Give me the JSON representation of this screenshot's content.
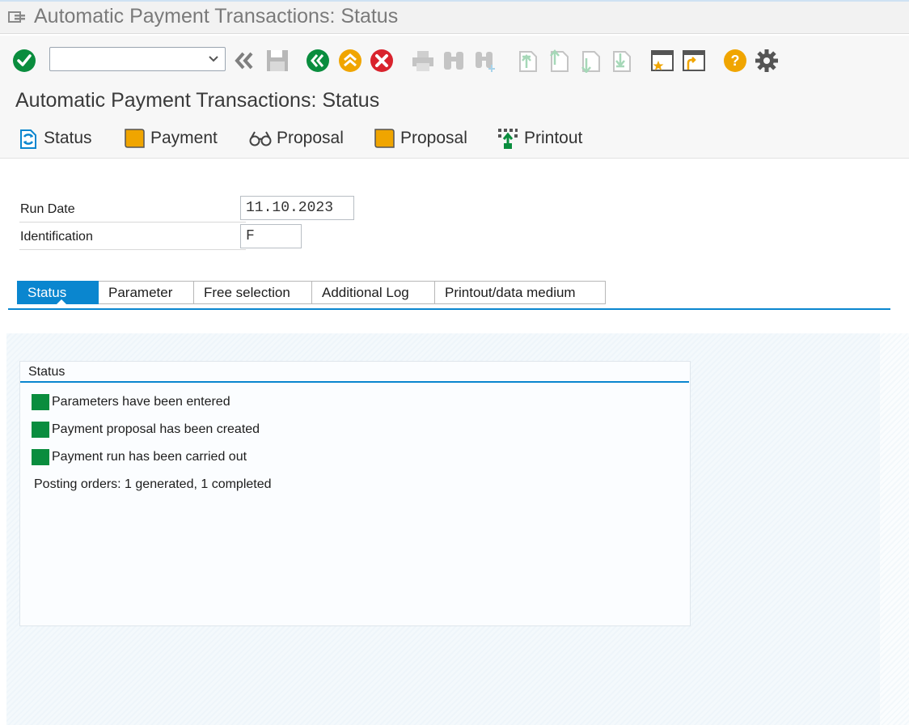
{
  "window": {
    "title": "Automatic Payment Transactions: Status"
  },
  "toolbar": {
    "command_field_value": "",
    "icons": [
      "enter-icon",
      "back-double-chevron-icon",
      "save-icon",
      "back-icon",
      "exit-icon",
      "cancel-icon",
      "print-icon",
      "find-icon",
      "find-next-icon",
      "first-page-icon",
      "previous-page-icon",
      "next-page-icon",
      "last-page-icon",
      "new-session-icon",
      "shortcut-icon",
      "help-icon",
      "settings-icon"
    ]
  },
  "screen": {
    "title": "Automatic Payment Transactions: Status"
  },
  "app_toolbar": {
    "status_label": "Status",
    "payment_label": "Payment",
    "proposal_display_label": "Proposal",
    "proposal_edit_label": "Proposal",
    "printout_label": "Printout"
  },
  "fields": {
    "run_date_label": "Run Date",
    "run_date_value": "11.10.2023",
    "identification_label": "Identification",
    "identification_value": "F"
  },
  "tabs": [
    {
      "label": "Status",
      "active": true
    },
    {
      "label": "Parameter",
      "active": false
    },
    {
      "label": "Free selection",
      "active": false
    },
    {
      "label": "Additional Log",
      "active": false
    },
    {
      "label": "Printout/data medium",
      "active": false
    }
  ],
  "status_box": {
    "title": "Status",
    "items": [
      {
        "text": "Parameters have been entered",
        "color": "#0a8d3e"
      },
      {
        "text": "Payment proposal has been created",
        "color": "#0a8d3e"
      },
      {
        "text": "Payment run has been carried out",
        "color": "#0a8d3e"
      }
    ],
    "posting_orders": "Posting orders: 1 generated, 1 completed"
  },
  "colors": {
    "accent": "#0a86cf",
    "status_green": "#0a8d3e",
    "action_green": "#0a8d3e",
    "action_orange": "#f0a500",
    "action_red": "#d9232d"
  }
}
